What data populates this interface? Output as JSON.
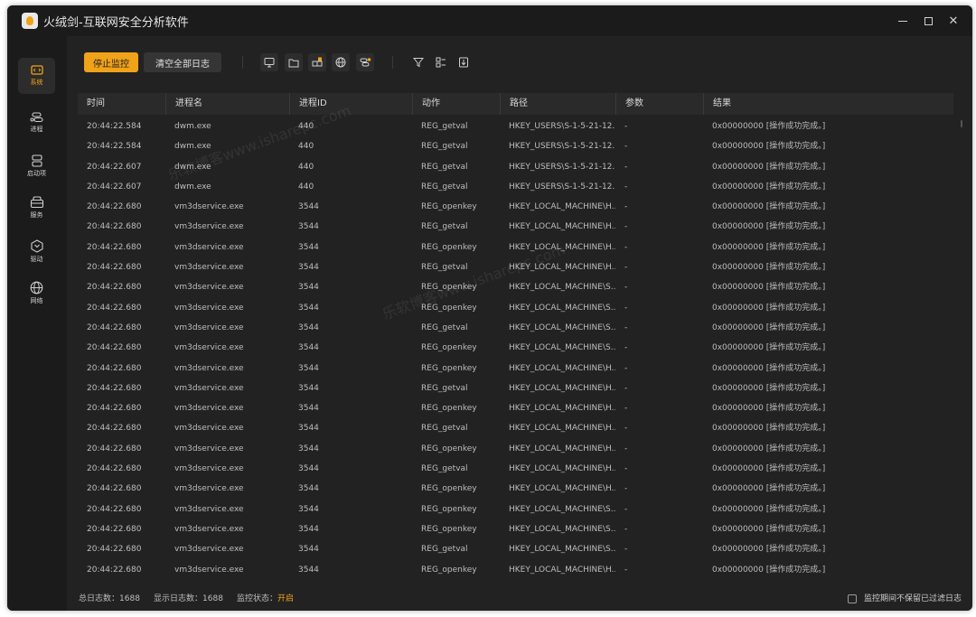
{
  "app": {
    "title": "火绒剑-互联网安全分析软件"
  },
  "sidebar": {
    "items": [
      {
        "label": "系统",
        "icon": "system-icon",
        "active": true
      },
      {
        "label": "进程",
        "icon": "process-icon"
      },
      {
        "label": "启动项",
        "icon": "startup-icon"
      },
      {
        "label": "服务",
        "icon": "service-icon"
      },
      {
        "label": "驱动",
        "icon": "driver-icon"
      },
      {
        "label": "网络",
        "icon": "network-icon"
      }
    ]
  },
  "toolbar": {
    "stop_label": "停止监控",
    "clear_label": "清空全部日志",
    "icons": [
      "monitor-icon",
      "folder-icon",
      "registry-icon",
      "globe-icon",
      "process-action-icon",
      "filter-icon",
      "columns-icon",
      "export-icon"
    ]
  },
  "table": {
    "columns": [
      "时间",
      "进程名",
      "进程ID",
      "动作",
      "路径",
      "参数",
      "结果"
    ],
    "rows": [
      [
        "20:44:22.584",
        "dwm.exe",
        "440",
        "REG_getval",
        "HKEY_USERS\\S-1-5-21-12...",
        "-",
        "0x00000000 [操作成功完成。]"
      ],
      [
        "20:44:22.584",
        "dwm.exe",
        "440",
        "REG_getval",
        "HKEY_USERS\\S-1-5-21-12...",
        "-",
        "0x00000000 [操作成功完成。]"
      ],
      [
        "20:44:22.607",
        "dwm.exe",
        "440",
        "REG_getval",
        "HKEY_USERS\\S-1-5-21-12...",
        "-",
        "0x00000000 [操作成功完成。]"
      ],
      [
        "20:44:22.607",
        "dwm.exe",
        "440",
        "REG_getval",
        "HKEY_USERS\\S-1-5-21-12...",
        "-",
        "0x00000000 [操作成功完成。]"
      ],
      [
        "20:44:22.680",
        "vm3dservice.exe",
        "3544",
        "REG_openkey",
        "HKEY_LOCAL_MACHINE\\H...",
        "-",
        "0x00000000 [操作成功完成。]"
      ],
      [
        "20:44:22.680",
        "vm3dservice.exe",
        "3544",
        "REG_getval",
        "HKEY_LOCAL_MACHINE\\H...",
        "-",
        "0x00000000 [操作成功完成。]"
      ],
      [
        "20:44:22.680",
        "vm3dservice.exe",
        "3544",
        "REG_openkey",
        "HKEY_LOCAL_MACHINE\\H...",
        "-",
        "0x00000000 [操作成功完成。]"
      ],
      [
        "20:44:22.680",
        "vm3dservice.exe",
        "3544",
        "REG_getval",
        "HKEY_LOCAL_MACHINE\\H...",
        "-",
        "0x00000000 [操作成功完成。]"
      ],
      [
        "20:44:22.680",
        "vm3dservice.exe",
        "3544",
        "REG_openkey",
        "HKEY_LOCAL_MACHINE\\S...",
        "-",
        "0x00000000 [操作成功完成。]"
      ],
      [
        "20:44:22.680",
        "vm3dservice.exe",
        "3544",
        "REG_openkey",
        "HKEY_LOCAL_MACHINE\\S...",
        "-",
        "0x00000000 [操作成功完成。]"
      ],
      [
        "20:44:22.680",
        "vm3dservice.exe",
        "3544",
        "REG_getval",
        "HKEY_LOCAL_MACHINE\\S...",
        "-",
        "0x00000000 [操作成功完成。]"
      ],
      [
        "20:44:22.680",
        "vm3dservice.exe",
        "3544",
        "REG_openkey",
        "HKEY_LOCAL_MACHINE\\S...",
        "-",
        "0x00000000 [操作成功完成。]"
      ],
      [
        "20:44:22.680",
        "vm3dservice.exe",
        "3544",
        "REG_openkey",
        "HKEY_LOCAL_MACHINE\\H...",
        "-",
        "0x00000000 [操作成功完成。]"
      ],
      [
        "20:44:22.680",
        "vm3dservice.exe",
        "3544",
        "REG_getval",
        "HKEY_LOCAL_MACHINE\\H...",
        "-",
        "0x00000000 [操作成功完成。]"
      ],
      [
        "20:44:22.680",
        "vm3dservice.exe",
        "3544",
        "REG_openkey",
        "HKEY_LOCAL_MACHINE\\H...",
        "-",
        "0x00000000 [操作成功完成。]"
      ],
      [
        "20:44:22.680",
        "vm3dservice.exe",
        "3544",
        "REG_getval",
        "HKEY_LOCAL_MACHINE\\H...",
        "-",
        "0x00000000 [操作成功完成。]"
      ],
      [
        "20:44:22.680",
        "vm3dservice.exe",
        "3544",
        "REG_openkey",
        "HKEY_LOCAL_MACHINE\\H...",
        "-",
        "0x00000000 [操作成功完成。]"
      ],
      [
        "20:44:22.680",
        "vm3dservice.exe",
        "3544",
        "REG_getval",
        "HKEY_LOCAL_MACHINE\\H...",
        "-",
        "0x00000000 [操作成功完成。]"
      ],
      [
        "20:44:22.680",
        "vm3dservice.exe",
        "3544",
        "REG_openkey",
        "HKEY_LOCAL_MACHINE\\H...",
        "-",
        "0x00000000 [操作成功完成。]"
      ],
      [
        "20:44:22.680",
        "vm3dservice.exe",
        "3544",
        "REG_openkey",
        "HKEY_LOCAL_MACHINE\\S...",
        "-",
        "0x00000000 [操作成功完成。]"
      ],
      [
        "20:44:22.680",
        "vm3dservice.exe",
        "3544",
        "REG_openkey",
        "HKEY_LOCAL_MACHINE\\S...",
        "-",
        "0x00000000 [操作成功完成。]"
      ],
      [
        "20:44:22.680",
        "vm3dservice.exe",
        "3544",
        "REG_getval",
        "HKEY_LOCAL_MACHINE\\S...",
        "-",
        "0x00000000 [操作成功完成。]"
      ],
      [
        "20:44:22.680",
        "vm3dservice.exe",
        "3544",
        "REG_openkey",
        "HKEY_LOCAL_MACHINE\\H...",
        "-",
        "0x00000000 [操作成功完成。]"
      ]
    ]
  },
  "status": {
    "total_label": "总日志数：",
    "total_value": "1688",
    "shown_label": "显示日志数：",
    "shown_value": "1688",
    "monitor_label": "监控状态：",
    "monitor_value": "开启",
    "keep_filtered_label": "监控期间不保留已过滤日志"
  },
  "watermark": {
    "text1": "乐软博客www.isharepc.com",
    "text2": "乐软博客www.isharepc.com"
  },
  "colors": {
    "accent": "#f0a218",
    "background": "#222222",
    "sidebar": "#1b1b1b"
  }
}
